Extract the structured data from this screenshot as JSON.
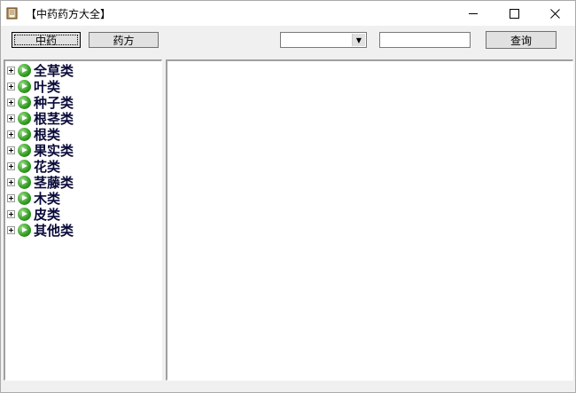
{
  "window": {
    "title": "【中药药方大全】"
  },
  "toolbar": {
    "herb_button": "中药",
    "prescription_button": "药方",
    "search_button": "查询",
    "dropdown_value": "",
    "search_value": ""
  },
  "tree": {
    "items": [
      {
        "label": "全草类"
      },
      {
        "label": "叶类"
      },
      {
        "label": "种子类"
      },
      {
        "label": "根茎类"
      },
      {
        "label": "根类"
      },
      {
        "label": "果实类"
      },
      {
        "label": "花类"
      },
      {
        "label": "茎藤类"
      },
      {
        "label": "木类"
      },
      {
        "label": "皮类"
      },
      {
        "label": "其他类"
      }
    ]
  }
}
